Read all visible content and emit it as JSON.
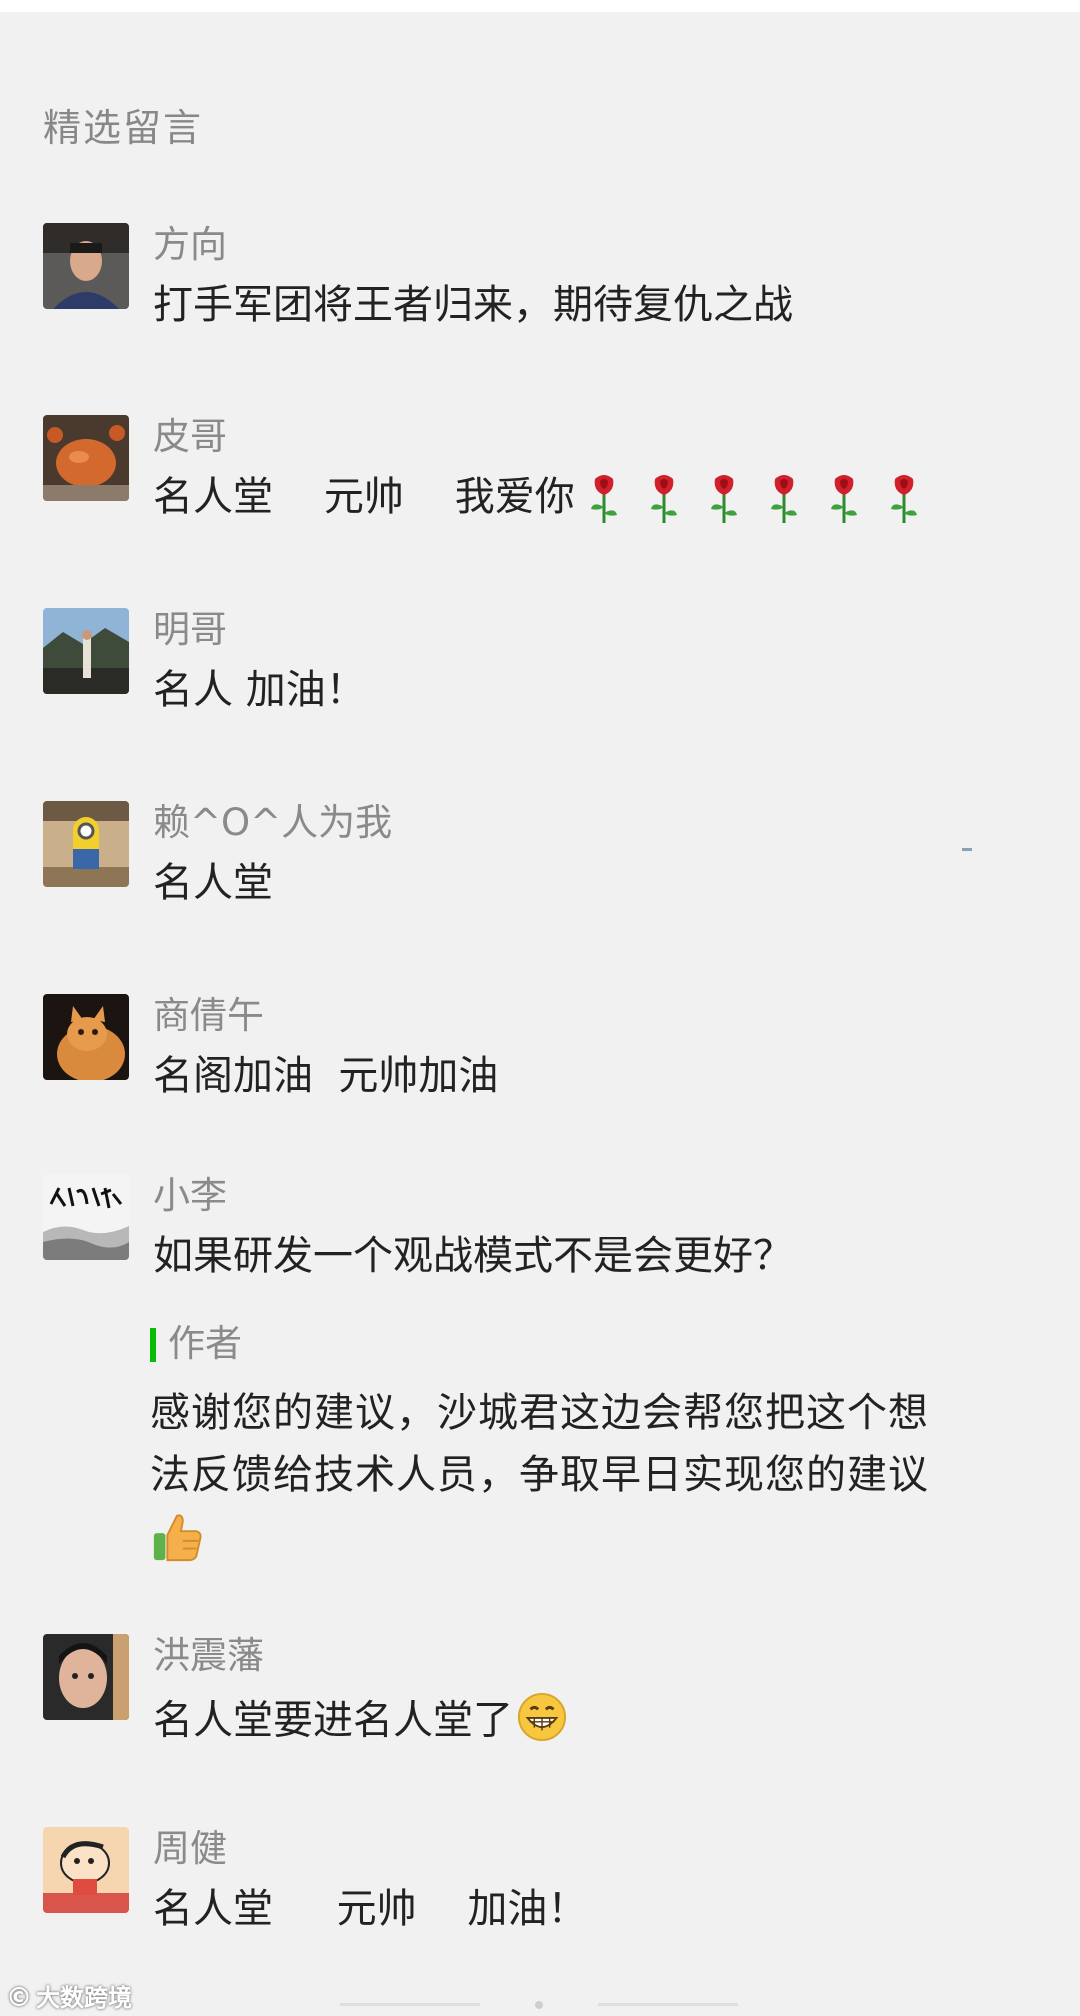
{
  "section": {
    "title": "精选留言"
  },
  "comments": [
    {
      "nickname": "方向",
      "content": "打手军团将王者归来，期待复仇之战"
    },
    {
      "nickname": "皮哥",
      "content": "名人堂    元帅    我爱你",
      "emoji": "rose-icon",
      "emoji_count": 6
    },
    {
      "nickname": "明哥",
      "content": "名人 加油！"
    },
    {
      "nickname": "赖^O^人为我",
      "content": "名人堂"
    },
    {
      "nickname": "商倩午",
      "content": "名阁加油  元帅加油"
    },
    {
      "nickname": "小李",
      "content": "如果研发一个观战模式不是会更好？",
      "reply": {
        "label": "作者",
        "line1": "感谢您的建议，沙城君这边会帮您把这个想",
        "line2": "法反馈给技术人员，争取早日实现您的建议",
        "emoji": "thumbs-up-icon"
      }
    },
    {
      "nickname": "洪震藩",
      "content": "名人堂要进名人堂了",
      "emoji": "grin-face-icon"
    },
    {
      "nickname": "周健",
      "content": "名人堂     元帅    加油！"
    }
  ],
  "watermark": {
    "text": "大数跨境"
  },
  "colors": {
    "background": "#f1f1f1",
    "nickname": "#8a8a8a",
    "content": "#222222",
    "author_bar": "#09bb07"
  }
}
